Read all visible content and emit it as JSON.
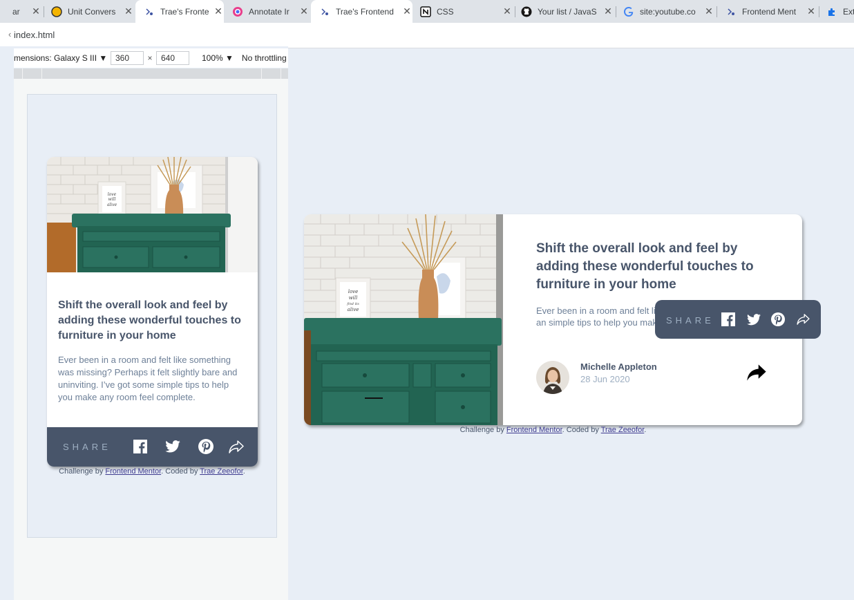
{
  "browser": {
    "tabs": [
      {
        "title": "ar",
        "icon": "extension-icon"
      },
      {
        "title": "Unit Convers",
        "icon": "unit-converter-icon"
      },
      {
        "title": "Trae's Fronte",
        "icon": "frontend-mentor-icon"
      },
      {
        "title": "Annotate Ir",
        "icon": "annotate-icon"
      },
      {
        "title": "Trae's Frontend",
        "icon": "frontend-mentor-icon"
      },
      {
        "title": "CSS",
        "icon": "notion-icon"
      },
      {
        "title": "Your list / JavaS",
        "icon": "github-icon"
      },
      {
        "title": "site:youtube.co",
        "icon": "google-icon"
      },
      {
        "title": "Frontend Ment",
        "icon": "frontend-mentor-icon"
      },
      {
        "title": "Ext",
        "icon": "puzzle-icon"
      }
    ],
    "url": "index.html"
  },
  "devtools": {
    "dimensions_label": "mensions: Galaxy S III",
    "width": "360",
    "height": "640",
    "times": "×",
    "zoom": "100%",
    "throttling": "No throttling"
  },
  "card": {
    "title": "Shift the overall look and feel by adding these wonderful touches to furniture in your home",
    "description": "Ever been in a room and felt like something was missing? Perhaps it felt slightly bare and uninviting. I’ve got some simple tips to help you make any room feel complete.",
    "description_desktop_visible": "Ever been in a room and felt lik Perhaps it felt slightly bare an simple tips to help you make a",
    "author_name": "Michelle Appleton",
    "date": "28 Jun 2020",
    "share_label": "SHARE",
    "share_icons": [
      "facebook-icon",
      "twitter-icon",
      "pinterest-icon",
      "share-arrow-icon"
    ],
    "frame_text": "love will find its alive"
  },
  "attribution": {
    "prefix": "Challenge by ",
    "link1": "Frontend Mentor",
    "middle": ". Coded by ",
    "link2": "Trae Zeeofor",
    "suffix": "."
  },
  "colors": {
    "page_bg": "#e8eef6",
    "dark_blue": "#48556a",
    "grayish_blue": "#6e8098",
    "light_grayish_blue": "#9eafc2"
  }
}
